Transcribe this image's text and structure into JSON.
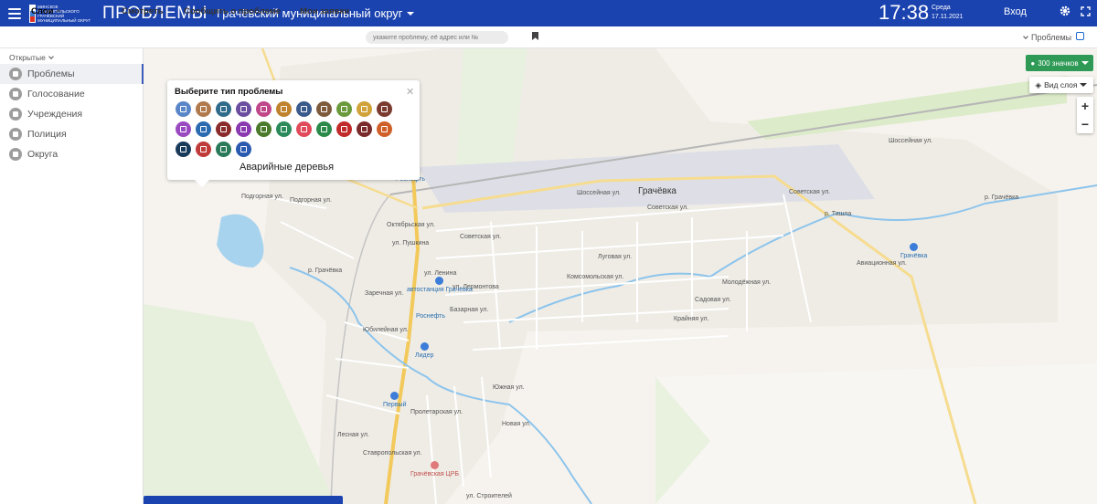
{
  "header": {
    "logo_text": [
      "Минское Ставропольского",
      "Грачёвский",
      "муниципальный округ"
    ],
    "title": "ПРОБЛЕМЫ",
    "district": "Грачёвский муниципальный округ",
    "time": "17:38",
    "weekday": "Среда",
    "date": "17.11.2021",
    "login": "Вход",
    "icons": [
      "menu-icon",
      "gear-icon",
      "fullscreen-icon"
    ]
  },
  "toolbar": {
    "layers": "Слои",
    "links": [
      "Смотреть",
      "Сообщить о проблеме",
      "Мои заявки"
    ],
    "search_placeholder": "укажите проблему, её адрес или №",
    "filter": "Проблемы"
  },
  "sidebar": {
    "filter": "Открытые",
    "items": [
      {
        "label": "Проблемы",
        "icon": "problems-icon",
        "active": true
      },
      {
        "label": "Голосование",
        "icon": "vote-icon",
        "active": false
      },
      {
        "label": "Учреждения",
        "icon": "building-icon",
        "active": false
      },
      {
        "label": "Полиция",
        "icon": "police-icon",
        "active": false
      },
      {
        "label": "Округа",
        "icon": "district-icon",
        "active": false
      }
    ]
  },
  "popup": {
    "title": "Выберите тип проблемы",
    "hint": "Аварийные деревья",
    "categories": [
      "#5a86c8",
      "#b07a4c",
      "#2f6b8a",
      "#6b4ea0",
      "#c0478a",
      "#c0822c",
      "#3a5a8c",
      "#7e5a3c",
      "#6a9a3c",
      "#d1a23a",
      "#7a3a30",
      "#9a4ac0",
      "#2a6ab0",
      "#8a2a2a",
      "#8a3ab0",
      "#4a7a2a",
      "#2a8a5a",
      "#e04a5a",
      "#2a8a4a",
      "#c02a2a",
      "#7a2a2a",
      "#d0602a",
      "#1a3a5a",
      "#c03a3a",
      "#2a7a5a",
      "#2a5ab0"
    ]
  },
  "map": {
    "count_button": "300 значков",
    "layer_button": "Вид слоя",
    "town": "Грачёвка",
    "streets": [
      "Подгорная ул.",
      "Подгорная ул.",
      "Октябрьская ул.",
      "ул. Пушкина",
      "Советская ул.",
      "Советская ул.",
      "Советская ул.",
      "Шоссейная ул.",
      "Шоссейная ул.",
      "Луговая ул.",
      "Комсомольская ул.",
      "Садовая ул.",
      "Крайняя ул.",
      "ул. Ленина",
      "Ставропольская ул.",
      "Заречная ул.",
      "Юбилейная ул.",
      "Базарная ул.",
      "ул. Лермонтова",
      "Южная ул.",
      "Новая ул.",
      "Лесная ул.",
      "Авиационная ул.",
      "р. Грачёвка",
      "р. Грачёвка",
      "р. Ташла",
      "ул. Строителей",
      "Молодёжная ул.",
      "Пролетарская ул."
    ],
    "pois": [
      "Роснефть",
      "автостанция Грачёвка",
      "Роснефть",
      "Лидер",
      "Первый",
      "Грачёвская ЦРБ",
      "Грачёвка"
    ]
  },
  "colors": {
    "header": "#1b43b0",
    "accent_green": "#2e9a55",
    "road_yellow": "#f2c95a"
  }
}
